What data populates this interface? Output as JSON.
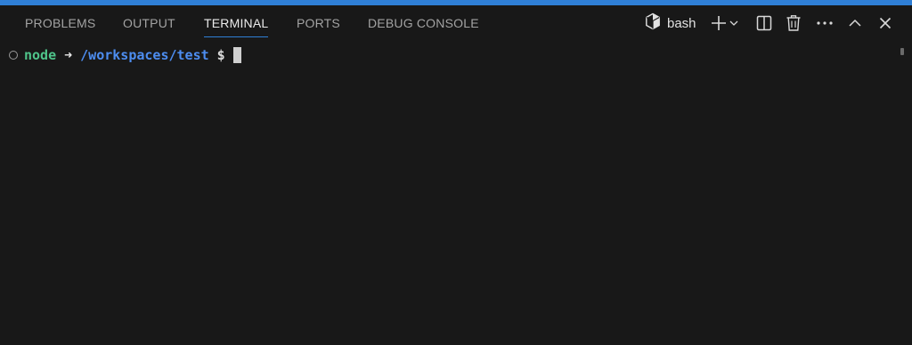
{
  "accent_color": "#2f7fd6",
  "background_color": "#181818",
  "tabs": [
    {
      "label": "PROBLEMS",
      "active": false
    },
    {
      "label": "OUTPUT",
      "active": false
    },
    {
      "label": "TERMINAL",
      "active": true
    },
    {
      "label": "PORTS",
      "active": false
    },
    {
      "label": "DEBUG CONSOLE",
      "active": false
    }
  ],
  "toolbar": {
    "shell_icon": "cube-icon",
    "shell_name": "bash",
    "new_terminal_icon": "plus-icon",
    "launch_profile_icon": "chevron-down-icon",
    "split_icon": "split-editor-icon",
    "kill_icon": "trash-icon",
    "more_icon": "ellipsis-icon",
    "maximize_icon": "chevron-up-icon",
    "close_icon": "close-icon"
  },
  "terminal": {
    "status_icon": "circle-outline-icon",
    "user": "node",
    "arrow": "➜",
    "path": "/workspaces/test",
    "symbol": "$",
    "user_color": "#4fc48a",
    "path_color": "#4d8df0"
  }
}
